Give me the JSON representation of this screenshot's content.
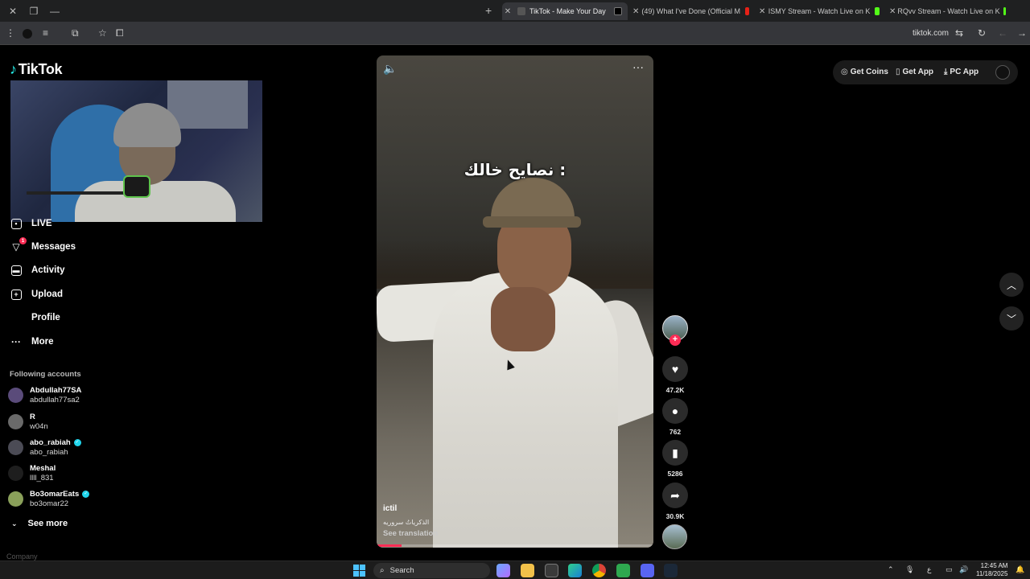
{
  "browser": {
    "tabs": [
      {
        "title": "TikTok - Make Your Day",
        "active": true
      },
      {
        "title": "(49) What I've Done (Official M",
        "active": false
      },
      {
        "title": "ISMY Stream - Watch Live on K",
        "active": false
      },
      {
        "title": "RQvv Stream - Watch Live on K",
        "active": false
      }
    ],
    "url": "tiktok.com"
  },
  "sidebar": {
    "logo": "TikTok",
    "nav": [
      {
        "label": "LIVE",
        "icon": "live-icon"
      },
      {
        "label": "Messages",
        "icon": "messages-icon",
        "badge": "1"
      },
      {
        "label": "Activity",
        "icon": "activity-icon"
      },
      {
        "label": "Upload",
        "icon": "upload-icon"
      },
      {
        "label": "Profile",
        "icon": "profile-icon"
      },
      {
        "label": "More",
        "icon": "more-icon"
      }
    ],
    "following_title": "Following accounts",
    "accounts": [
      {
        "name": "Abdullah77SA",
        "handle": "abdullah77sa2",
        "verified": false,
        "color": "#5a4b7a"
      },
      {
        "name": "R",
        "handle": "w04n",
        "verified": false,
        "color": "#6a6a6a"
      },
      {
        "name": "abo_rabiah",
        "handle": "abo_rabiah",
        "verified": true,
        "color": "#4b4b55"
      },
      {
        "name": "Meshal",
        "handle": "llll_831",
        "verified": false,
        "color": "#1e1e1e"
      },
      {
        "name": "Bo3omarEats",
        "handle": "bo3omar22",
        "verified": true,
        "color": "#8aa05a"
      }
    ],
    "see_more": "See more",
    "company": "Company"
  },
  "video": {
    "caption": "نصايح خالك :",
    "author": "ictil",
    "description": "الذكرياتُ سروريه",
    "see_translation": "See translation",
    "progress": 0.09
  },
  "actions": {
    "likes": "47.2K",
    "comments": "762",
    "saves": "5286",
    "shares": "30.9K"
  },
  "header": {
    "get_coins": "Get Coins",
    "get_app": "Get App",
    "pc_app": "PC App"
  },
  "taskbar": {
    "search": "Search",
    "lang": "ع",
    "time": "12:45 AM",
    "date": "11/18/2025"
  }
}
